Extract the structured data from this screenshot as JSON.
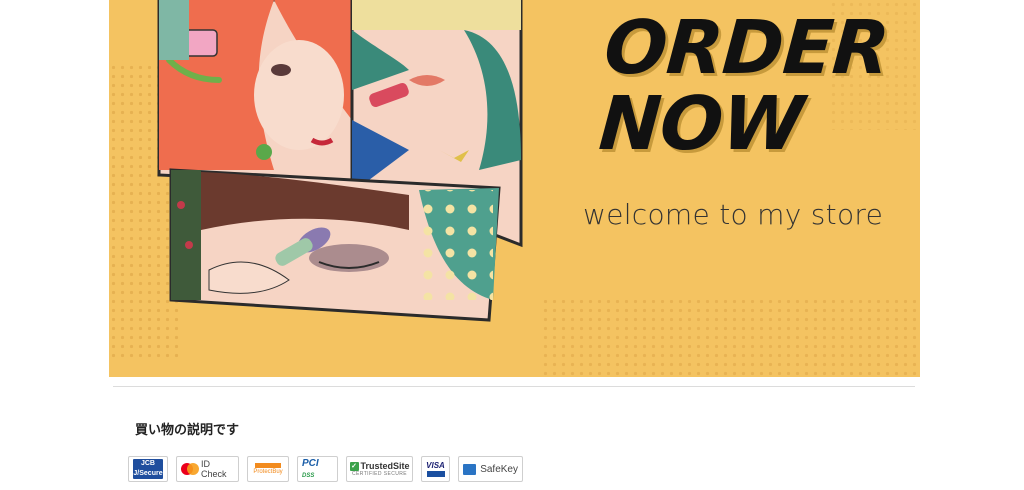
{
  "banner": {
    "headline_line1": "ORDER",
    "headline_line2": "NOW",
    "tagline": "welcome to my store",
    "colors": {
      "background": "#f4c361",
      "headline": "#111111"
    }
  },
  "description": {
    "text": "買い物の説明です"
  },
  "payment_badges": [
    {
      "icon": "jcb-secure-icon",
      "label": "JCB",
      "sublabel": "J/Secure"
    },
    {
      "icon": "mastercard-id-check-icon",
      "label": "ID Check"
    },
    {
      "icon": "protectbuy-icon",
      "label": "ProtectBuy"
    },
    {
      "icon": "pci-dss-icon",
      "label": "PCI",
      "sublabel": "DSS"
    },
    {
      "icon": "trustedsite-icon",
      "label": "TrustedSite",
      "sublabel": "CERTIFIED SECURE"
    },
    {
      "icon": "visa-secure-icon",
      "label": "VISA",
      "sublabel": "SECURE"
    },
    {
      "icon": "amex-safekey-icon",
      "label": "SafeKey"
    }
  ]
}
